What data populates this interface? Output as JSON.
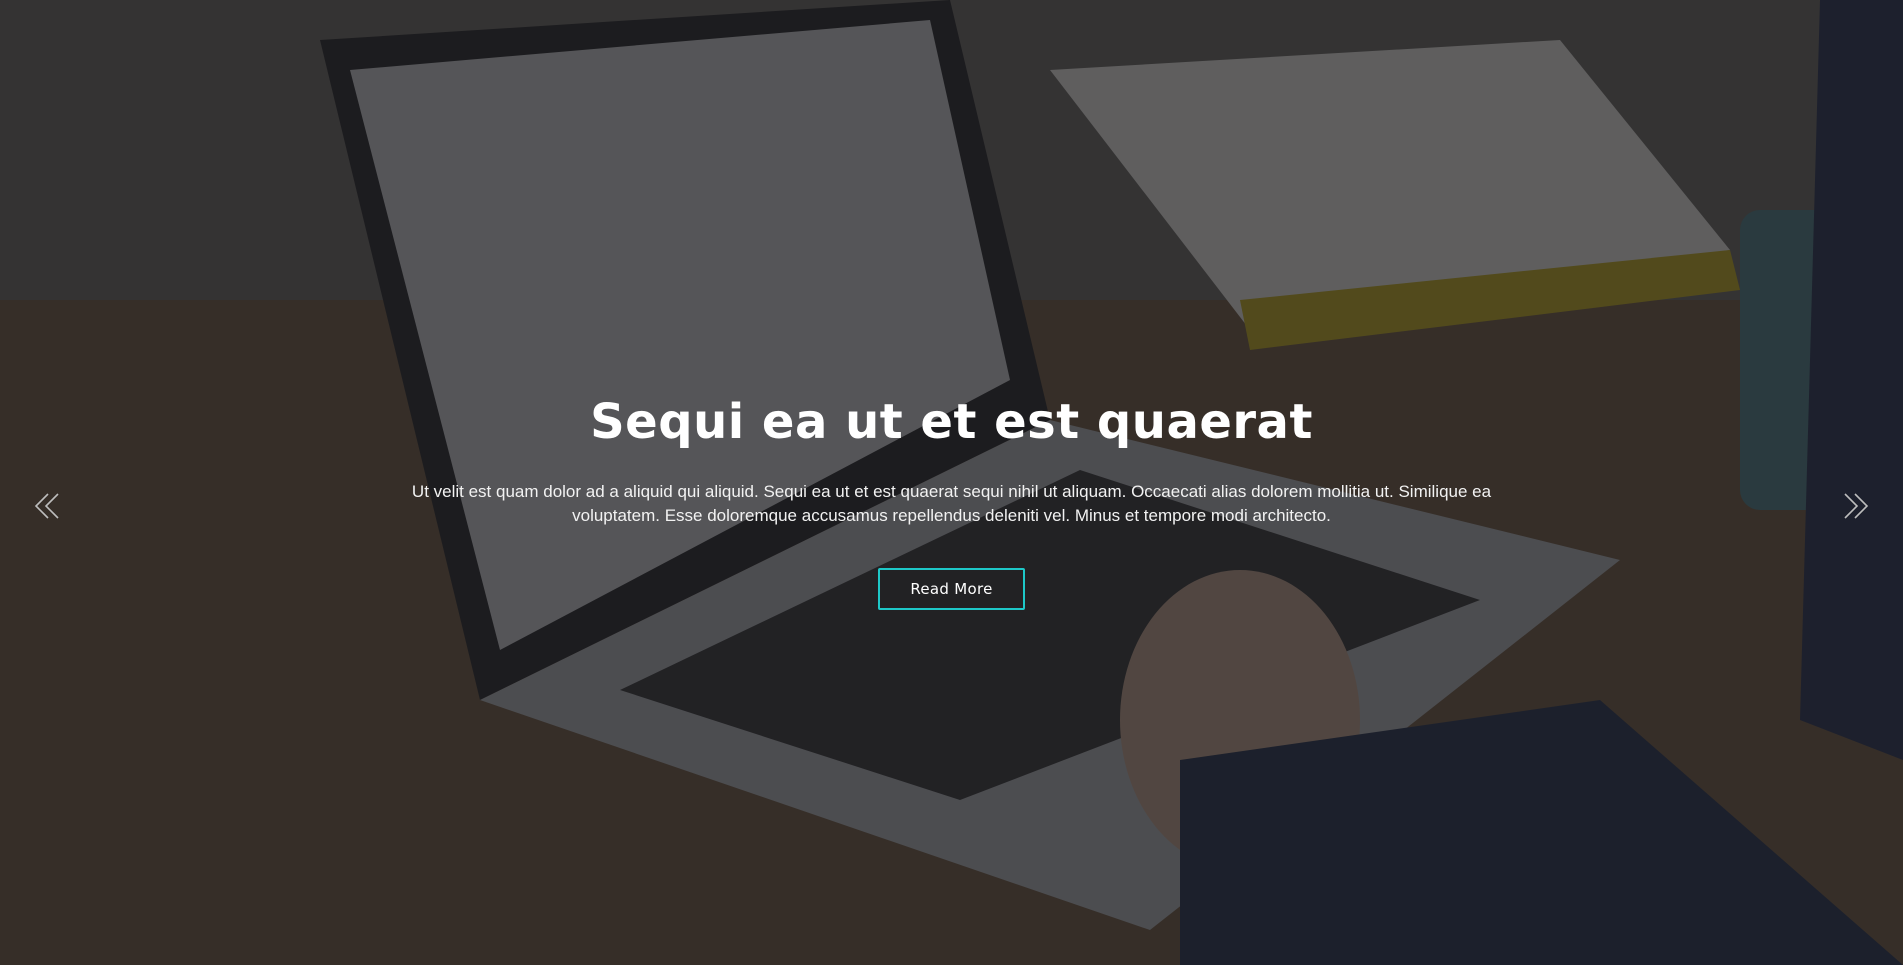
{
  "slider": {
    "title": "Sequi ea ut et est quaerat",
    "description": "Ut velit est quam dolor ad a aliquid qui aliquid. Sequi ea ut et est quaerat sequi nihil ut aliquam. Occaecati alias dolorem mollitia ut. Similique ea voluptatem. Esse doloremque accusamus repellendus deleniti vel. Minus et tempore modi architecto.",
    "button_label": "Read More",
    "prev_icon": "double-chevron-left-icon",
    "next_icon": "double-chevron-right-icon"
  },
  "colors": {
    "accent": "#1ec8c8",
    "text": "#ffffff",
    "arrow": "#bdbdbd"
  }
}
